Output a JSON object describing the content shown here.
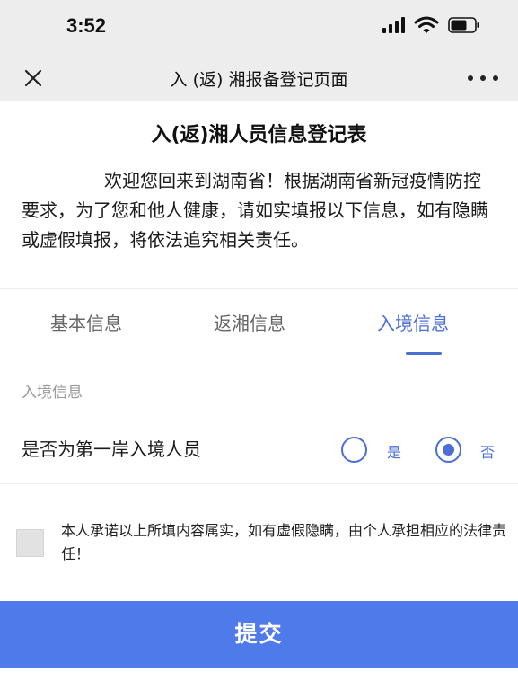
{
  "status_bar": {
    "time": "3:52",
    "icons": [
      "cellular-signal-icon",
      "wifi-icon",
      "battery-icon"
    ]
  },
  "nav_bar": {
    "title": "入 (返) 湘报备登记页面",
    "left_icon": "close-icon",
    "right_icon": "more-icon"
  },
  "form": {
    "title": "入(返)湘人员信息登记表",
    "intro": "欢迎您回来到湖南省！根据湖南省新冠疫情防控要求，为了您和他人健康，请如实填报以下信息，如有隐瞒或虚假填报，将依法追究相关责任。"
  },
  "tabs": [
    {
      "label": "基本信息",
      "active": false
    },
    {
      "label": "返湘信息",
      "active": false
    },
    {
      "label": "入境信息",
      "active": true
    }
  ],
  "section": {
    "label": "入境信息",
    "question": "是否为第一岸入境人员",
    "options": [
      {
        "label": "是",
        "checked": false
      },
      {
        "label": "否",
        "checked": true
      }
    ]
  },
  "commitment": {
    "checked": false,
    "text": "本人承诺以上所填内容属实，如有虚假隐瞒，由个人承担相应的法律责任！"
  },
  "submit": {
    "label": "提交"
  },
  "colors": {
    "accent": "#4b6fd6",
    "submit_bg": "#4f7bea",
    "header_bg": "#ededed"
  }
}
